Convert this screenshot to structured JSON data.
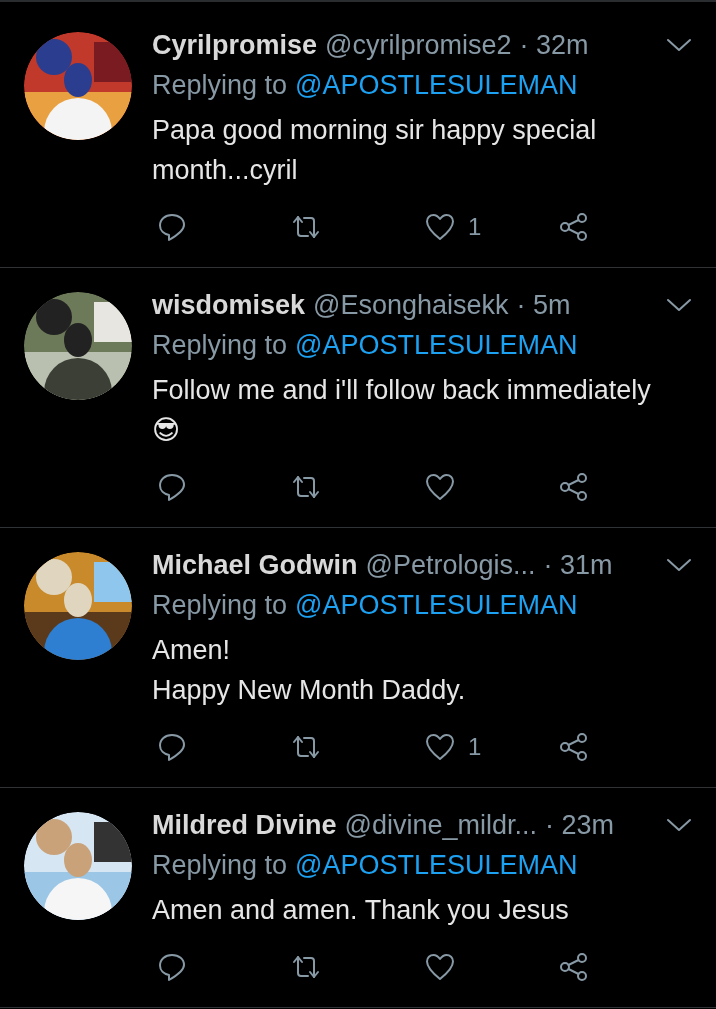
{
  "tweets": [
    {
      "name": "Cyrilpromise",
      "handle": "@cyrilpromise2",
      "time": "· 32m",
      "replying_label": "Replying to",
      "replying_to": "@APOSTLESULEMAN",
      "body": "Papa good morning sir happy special month...cyril",
      "likes": "1"
    },
    {
      "name": "wisdomisek",
      "handle": "@Esonghaisekk",
      "time": "· 5m",
      "replying_label": "Replying to",
      "replying_to": "@APOSTLESULEMAN",
      "body": "Follow me and i'll follow back immediately 😎"
    },
    {
      "name": "Michael Godwin",
      "handle": "@Petrologis...",
      "time": "· 31m",
      "replying_label": "Replying to",
      "replying_to": "@APOSTLESULEMAN",
      "body": "Amen!\nHappy New Month Daddy.",
      "likes": "1"
    },
    {
      "name": "Mildred Divine",
      "handle": "@divine_mildr...",
      "time": "· 23m",
      "replying_label": "Replying to",
      "replying_to": "@APOSTLESULEMAN",
      "body": "Amen and amen. Thank you Jesus"
    }
  ]
}
